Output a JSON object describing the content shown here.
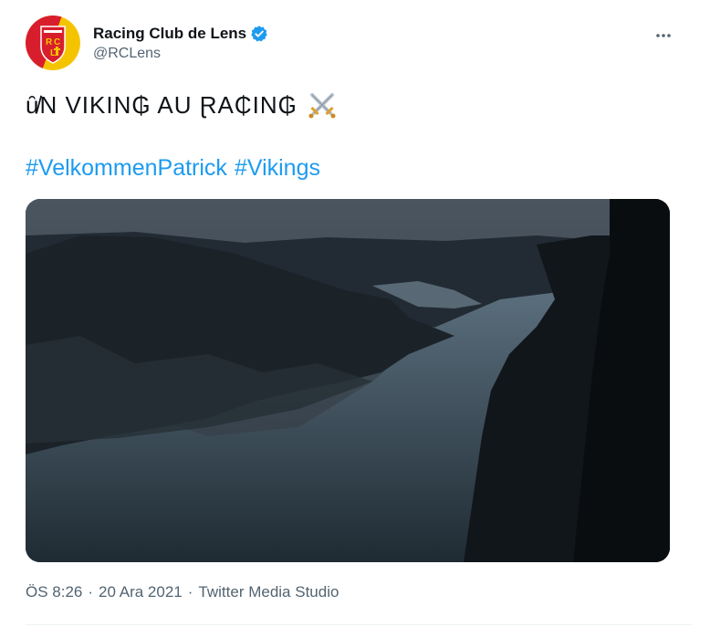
{
  "author": {
    "display_name": "Racing Club de Lens",
    "handle": "@RCLens",
    "avatar_icon": "rc-lens-crest-icon",
    "verified_icon": "verified-badge-icon",
    "crest_letters": "RCL"
  },
  "tweet": {
    "text_line": "ȗ̸N VIKIN₲ AU ⱤA₵IN₲",
    "emoji_icon": "crossed-swords-icon",
    "hashtags": [
      "#VelkommenPatrick",
      "#Vikings"
    ]
  },
  "media": {
    "type": "video",
    "description_icon": "fjord-video-thumbnail"
  },
  "meta": {
    "time": "ÖS 8:26",
    "separator1": "·",
    "date": "20 Ara 2021",
    "separator2": "·",
    "source": "Twitter Media Studio"
  },
  "colors": {
    "accent": "#1d9bf0",
    "secondary_text": "#536471",
    "primary_text": "#0f1419",
    "crest_red": "#d81e2c",
    "crest_yellow": "#f5c400"
  },
  "icons": {
    "more": "more-options-icon"
  }
}
